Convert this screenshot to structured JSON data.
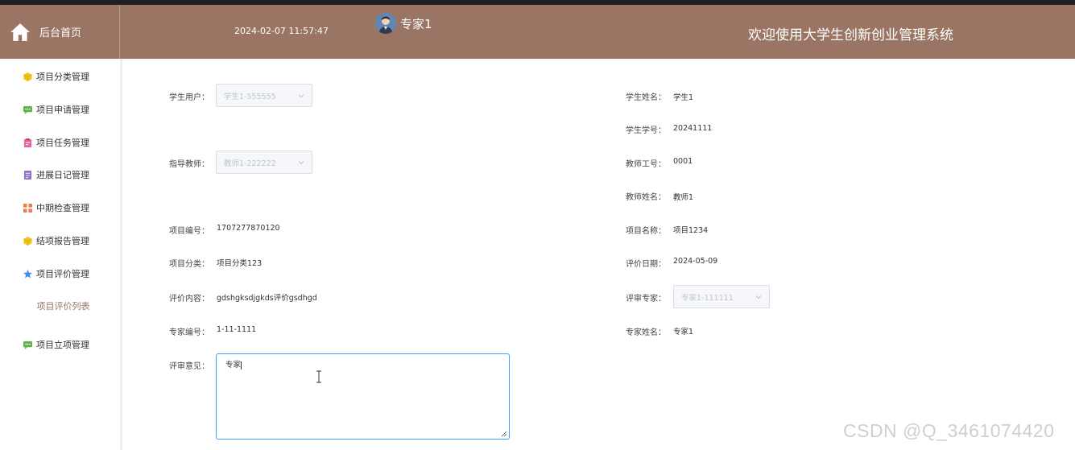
{
  "header": {
    "home_label": "后台首页",
    "datetime": "2024-02-07 11:57:47",
    "username": "专家1",
    "site_title": "欢迎使用大学生创新创业管理系统"
  },
  "sidebar": {
    "items": [
      {
        "label": "项目分类管理",
        "icon": "cube-icon",
        "color": "#f0c419"
      },
      {
        "label": "项目申请管理",
        "icon": "chat-icon",
        "color": "#5fb34a"
      },
      {
        "label": "项目任务管理",
        "icon": "clipboard-icon",
        "color": "#e2639d"
      },
      {
        "label": "进展日记管理",
        "icon": "document-icon",
        "color": "#8d6cc4"
      },
      {
        "label": "中期检查管理",
        "icon": "grid-icon",
        "color": "#f07c4a"
      },
      {
        "label": "结项报告管理",
        "icon": "cube-icon",
        "color": "#f0c419"
      },
      {
        "label": "项目评价管理",
        "icon": "star-icon",
        "color": "#3d8ef0"
      },
      {
        "label": "项目立项管理",
        "icon": "chat-icon",
        "color": "#5fb34a"
      }
    ],
    "submenu_label": "项目评价列表"
  },
  "form": {
    "student_user": {
      "label": "学生用户：",
      "value": "学生1-555555"
    },
    "student_name": {
      "label": "学生姓名：",
      "value": "学生1"
    },
    "student_no": {
      "label": "学生学号：",
      "value": "20241111"
    },
    "advisor": {
      "label": "指导教师：",
      "value": "教师1-222222"
    },
    "teacher_no": {
      "label": "教师工号：",
      "value": "0001"
    },
    "teacher_name": {
      "label": "教师姓名：",
      "value": "教师1"
    },
    "project_no": {
      "label": "项目编号：",
      "value": "1707277870120"
    },
    "project_name": {
      "label": "项目名称：",
      "value": "项目1234"
    },
    "project_category": {
      "label": "项目分类：",
      "value": "项目分类123"
    },
    "eval_date": {
      "label": "评价日期：",
      "value": "2024-05-09"
    },
    "eval_content": {
      "label": "评价内容：",
      "value": "gdshgksdjgkds评价gsdhgd"
    },
    "review_expert": {
      "label": "评审专家：",
      "value": "专家1-111111"
    },
    "expert_no": {
      "label": "专家编号：",
      "value": "1-11-1111"
    },
    "expert_name": {
      "label": "专家姓名：",
      "value": "专家1"
    },
    "review_opinion": {
      "label": "评审意见：",
      "value": "专家"
    }
  },
  "watermark": "CSDN @Q_3461074420",
  "colors": {
    "header_bg": "#9a7564",
    "focus_border": "#409eff",
    "submenu_text": "#9a7564"
  }
}
